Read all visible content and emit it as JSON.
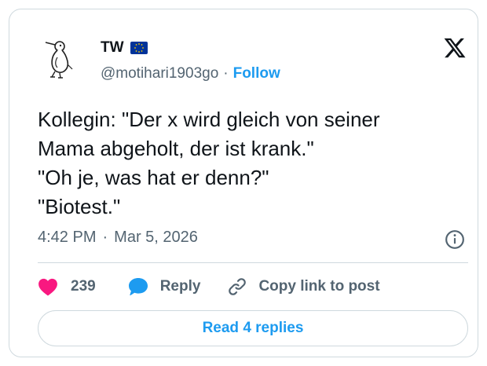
{
  "author": {
    "name": "TW",
    "handle": "@motihari1903go",
    "separator": "·",
    "follow_label": "Follow",
    "flag_icon": "eu-flag-icon",
    "avatar_icon": "bird-sketch-avatar"
  },
  "platform_icon": "x-logo-icon",
  "tweet": {
    "lines": [
      "Kollegin: \"Der x wird gleich von seiner",
      "Mama abgeholt, der ist krank.\"",
      "\"Oh je, was hat er denn?\"",
      "\"Biotest.\""
    ]
  },
  "meta": {
    "time": "4:42 PM",
    "separator": "·",
    "date": "Mar 5, 2026",
    "info_icon": "info-icon"
  },
  "actions": {
    "like_count": "239",
    "reply_label": "Reply",
    "copy_label": "Copy link to post"
  },
  "read_replies_label": "Read 4 replies",
  "colors": {
    "accent": "#1d9bf0",
    "heart": "#f91880",
    "secondary_text": "#536471",
    "border": "#cfd9de",
    "eu_flag_blue": "#003399",
    "eu_flag_stars": "#ffcc00"
  }
}
